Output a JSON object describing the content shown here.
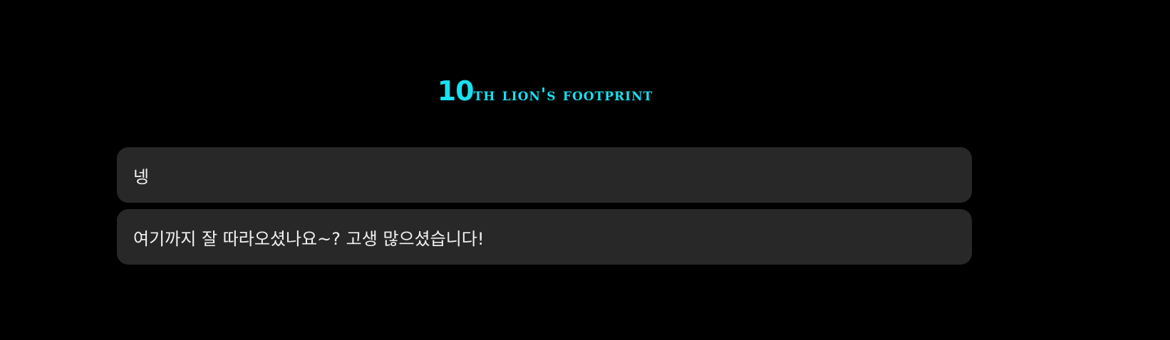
{
  "header": {
    "title_number": "10",
    "title_text": "th lion's footprint"
  },
  "colors": {
    "background": "#000000",
    "title_accent": "#16e0f0",
    "card_background": "#282828",
    "card_text": "#f2f2f2"
  },
  "messages": [
    {
      "text": "넹"
    },
    {
      "text": "여기까지 잘 따라오셨나요~? 고생 많으셨습니다!"
    }
  ]
}
